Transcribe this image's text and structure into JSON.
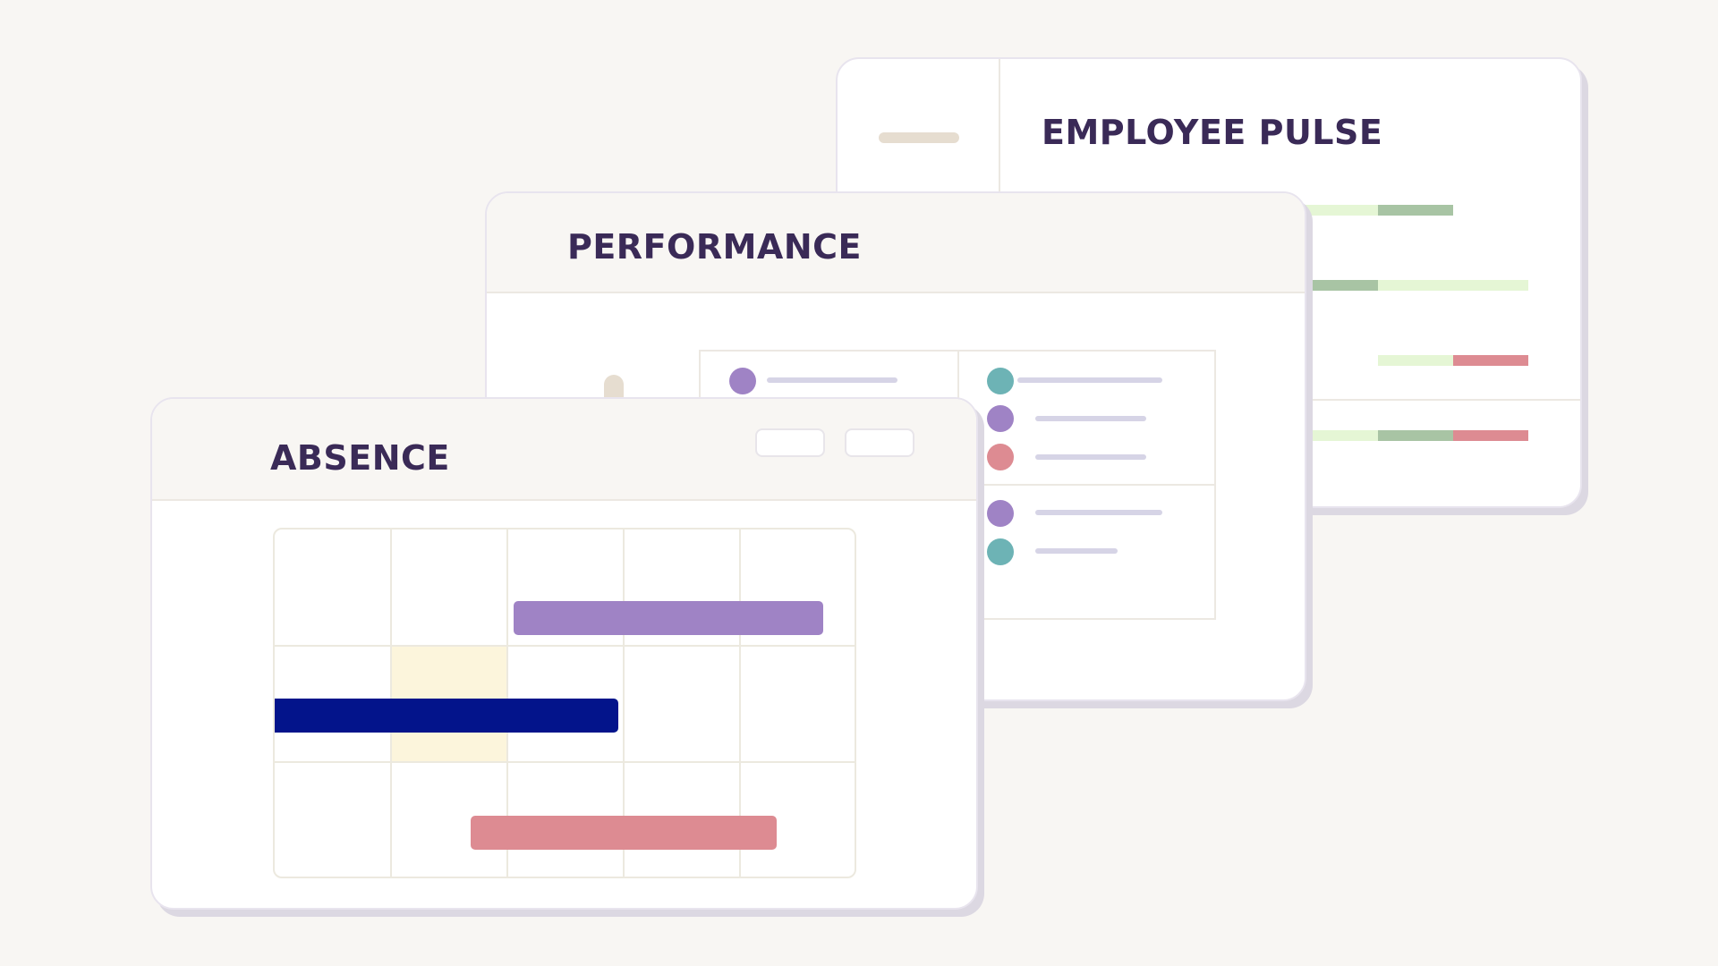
{
  "colors": {
    "background": "#f8f6f3",
    "title": "#3a2a57",
    "purple": "#9f83c5",
    "navy": "#03148b",
    "pink": "#dd8b92",
    "teal": "#6db3b5",
    "light_green": "#e5f6d5",
    "sage_green": "#a8c4a4",
    "highlight_cell": "#fcf5dc"
  },
  "pulse": {
    "title": "EMPLOYEE PULSE"
  },
  "performance": {
    "title": "PERFORMANCE"
  },
  "absence": {
    "title": "ABSENCE",
    "buttons": [
      "",
      ""
    ]
  }
}
